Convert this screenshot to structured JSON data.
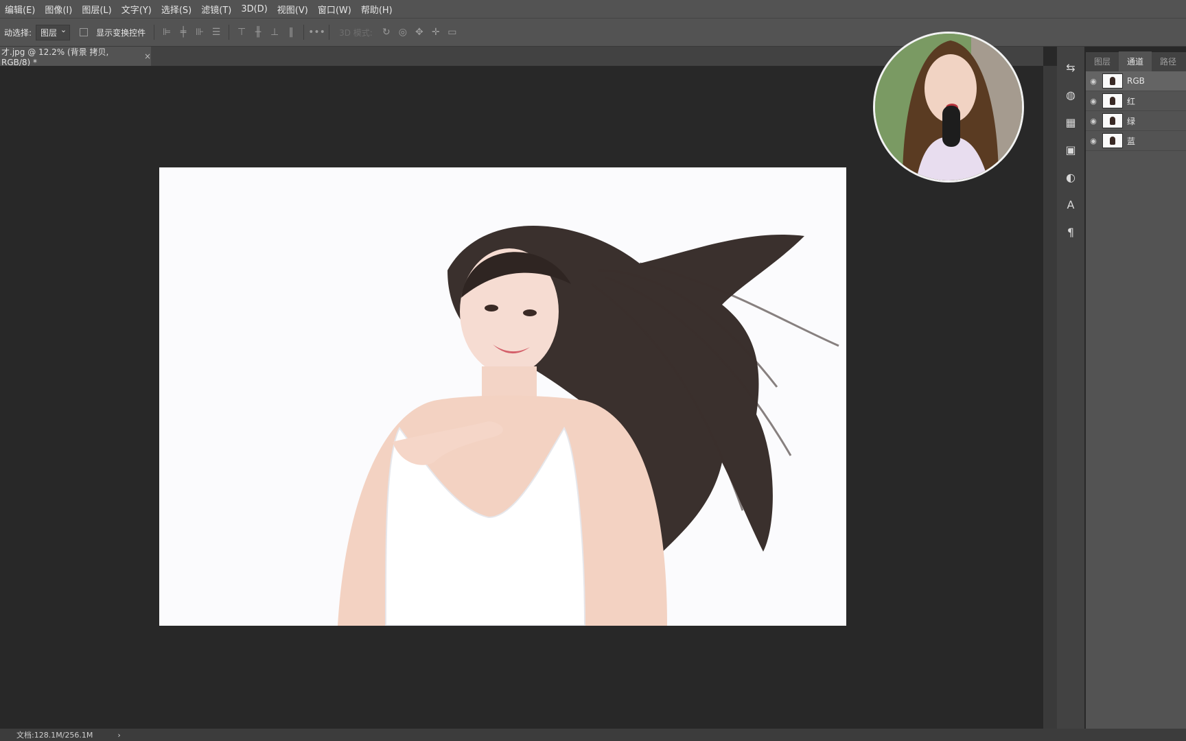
{
  "menu": {
    "items": [
      "编辑(E)",
      "图像(I)",
      "图层(L)",
      "文字(Y)",
      "选择(S)",
      "滤镜(T)",
      "3D(D)",
      "视图(V)",
      "窗口(W)",
      "帮助(H)"
    ]
  },
  "options": {
    "auto_select_label": "动选择:",
    "auto_select_value": "图层",
    "show_transform_label": "显示变换控件",
    "mode_3d_label": "3D 模式:",
    "more_label": "•••"
  },
  "document": {
    "tab_title": "才.jpg @ 12.2% (背景 拷贝, RGB/8) *",
    "close_glyph": "×"
  },
  "panel": {
    "tabs": [
      "图层",
      "通道",
      "路径"
    ],
    "active_tab": "通道",
    "channels": [
      {
        "name": "RGB",
        "selected": true
      },
      {
        "name": "红",
        "selected": false
      },
      {
        "name": "绿",
        "selected": false
      },
      {
        "name": "蓝",
        "selected": false
      }
    ]
  },
  "status": {
    "doc_info": "文档:128.1M/256.1M",
    "arrow": "›"
  },
  "colors": {
    "menu_bg": "#535353",
    "canvas_bg": "#282828",
    "panel_bg": "#535353",
    "photo_bg": "#fbfbfd"
  }
}
